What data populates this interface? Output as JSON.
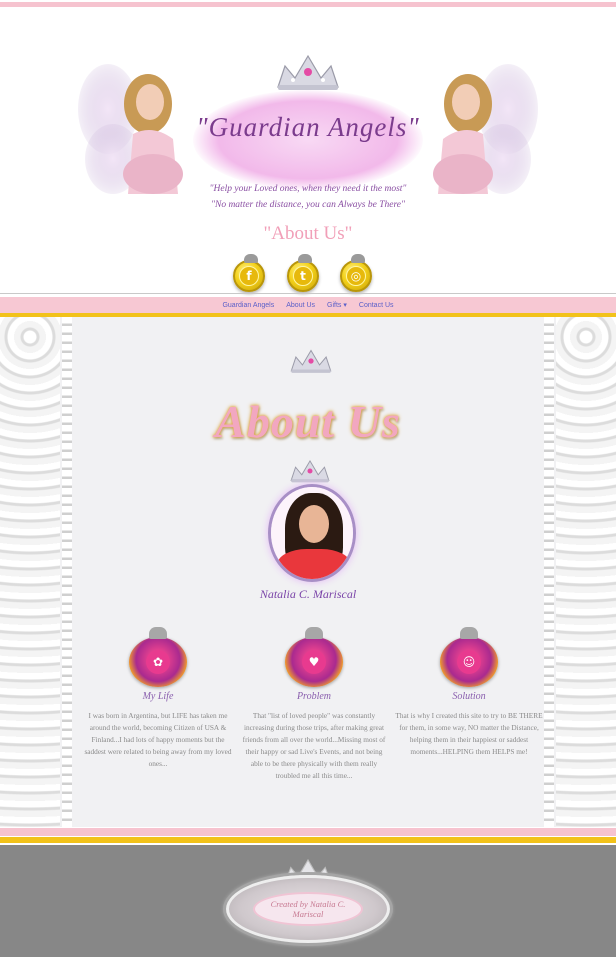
{
  "header": {
    "banner_title": "\"Guardian Angels\"",
    "tagline_1": "\"Help your Loved ones, when they need it the most\"",
    "tagline_2": "\"No matter the distance, you can Always be There\"",
    "page_subtitle": "\"About Us\""
  },
  "social": [
    {
      "icon": "facebook-icon",
      "glyph": "f"
    },
    {
      "icon": "twitter-icon",
      "glyph": "t"
    },
    {
      "icon": "instagram-icon",
      "glyph": "◎"
    }
  ],
  "nav": {
    "items": [
      "Guardian Angels",
      "About Us",
      "Gifts",
      "Contact Us"
    ],
    "dropdown_marker": "▾"
  },
  "about": {
    "title": "About Us",
    "signature": "Natalia C. Mariscal"
  },
  "features": [
    {
      "label": "My Life",
      "icon": "baby-icon",
      "glyph": "✿",
      "text": "I was born in Argentina, but LIFE has taken me around the world, becoming Citizen of USA & Finland...I had lots of happy moments but the saddest were related to being away from my loved ones..."
    },
    {
      "label": "Problem",
      "icon": "heart-icon",
      "glyph": "♥",
      "text": "That \"list of loved people\" was constantly increasing during those trips, after making great friends from all over the world...Missing most of their happy or sad Live's Events, and not being able to be there physically with them really troubled me all this time..."
    },
    {
      "label": "Solution",
      "icon": "angel-icon",
      "glyph": "☺",
      "text": "That is why I created this site to try to BE THERE for them, in some way, NO matter the Distance, helping them in their happiest or saddest moments...HELPING them HELPS me!"
    }
  ],
  "footer": {
    "badge_text": "Created by Natalia C. Mariscal"
  },
  "colors": {
    "pink": "#f6c3cf",
    "yellow": "#f2c21a",
    "nav_link": "#5a5fc9",
    "footer_grey": "#878787"
  }
}
